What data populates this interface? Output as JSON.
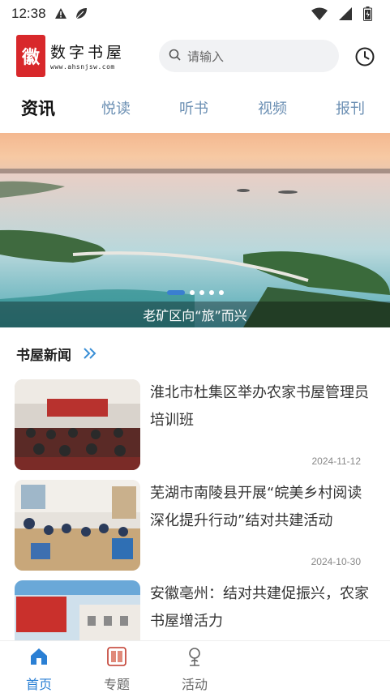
{
  "status_bar": {
    "time": "12:38",
    "icons": [
      "warning-icon",
      "leaf-icon",
      "wifi-icon",
      "signal-icon",
      "battery-icon"
    ]
  },
  "header": {
    "logo_seal_char": "徽",
    "logo_name": "数字书屋",
    "logo_url": "www.ahsnjsw.com",
    "search_placeholder": "请输入",
    "history_icon": "clock-icon"
  },
  "tabs": [
    {
      "label": "资讯",
      "active": true
    },
    {
      "label": "悦读",
      "active": false
    },
    {
      "label": "听书",
      "active": false
    },
    {
      "label": "视频",
      "active": false
    },
    {
      "label": "报刊",
      "active": false
    }
  ],
  "banner": {
    "caption": "老矿区向“旅”而兴",
    "dot_count": 5,
    "active_dot": 0
  },
  "section": {
    "title": "书屋新闻",
    "more_icon": "double-chevron-right-icon"
  },
  "news": [
    {
      "title": "淮北市杜集区举办农家书屋管理员培训班",
      "date": "2024-11-12"
    },
    {
      "title": "芜湖市南陵县开展“皖美乡村阅读深化提升行动”结对共建活动",
      "date": "2024-10-30"
    },
    {
      "title": "安徽亳州：结对共建促振兴，农家书屋增活力",
      "date": ""
    }
  ],
  "bottom_nav": [
    {
      "label": "首页",
      "icon": "home-icon",
      "active": true
    },
    {
      "label": "专题",
      "icon": "topic-icon",
      "active": false
    },
    {
      "label": "活动",
      "icon": "activity-icon",
      "active": false
    }
  ],
  "colors": {
    "accent": "#2a7fd4",
    "tab_inactive": "#6b8fb3",
    "seal_red": "#d8282b"
  }
}
